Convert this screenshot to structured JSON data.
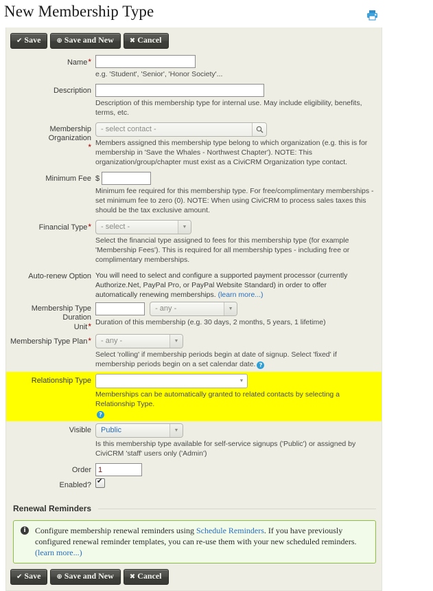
{
  "page": {
    "title": "New Membership Type",
    "print_icon": "printer-icon"
  },
  "toolbar": {
    "save_label": "Save",
    "save_icon": "✔",
    "save_new_label": "Save and New",
    "save_new_icon": "⊕",
    "cancel_label": "Cancel",
    "cancel_icon": "✖"
  },
  "fields": {
    "name": {
      "label": "Name",
      "required": "*",
      "value": "",
      "help": "e.g. 'Student', 'Senior', 'Honor Society'..."
    },
    "description": {
      "label": "Description",
      "value": "",
      "help": "Description of this membership type for internal use. May include eligibility, benefits, terms, etc."
    },
    "membership_organization": {
      "label": "Membership Organization",
      "required": "*",
      "value": "- select contact -",
      "search_icon": "search-icon",
      "help": "Members assigned this membership type belong to which organization (e.g. this is for membership in 'Save the Whales - Northwest Chapter'). NOTE: This organization/group/chapter must exist as a CiviCRM Organization type contact."
    },
    "minimum_fee": {
      "label": "Minimum Fee",
      "currency": "$",
      "value": "",
      "help": "Minimum fee required for this membership type. For free/complimentary memberships - set minimum fee to zero (0). NOTE: When using CiviCRM to process sales taxes this should be the tax exclusive amount."
    },
    "financial_type": {
      "label": "Financial Type",
      "required": "*",
      "value": "- select -",
      "help": "Select the financial type assigned to fees for this membership type (for example 'Membership Fees'). This is required for all membership types - including free or complimentary memberships."
    },
    "auto_renew": {
      "label": "Auto-renew Option",
      "text": "You will need to select and configure a supported payment processor (currently Authorize.Net, PayPal Pro, or PayPal Website Standard) in order to offer automatically renewing memberships.",
      "learn_more": "(learn more...)"
    },
    "duration": {
      "label_line1": "Membership Type Duration",
      "label_line2": "Unit",
      "required": "*",
      "interval_value": "",
      "unit_value": "- any -",
      "help": "Duration of this membership (e.g. 30 days, 2 months, 5 years, 1 lifetime)"
    },
    "plan": {
      "label": "Membership Type Plan",
      "required": "*",
      "value": "- any -",
      "help": "Select 'rolling' if membership periods begin at date of signup. Select 'fixed' if membership periods begin on a set calendar date.",
      "help_icon": "question-icon"
    },
    "relationship_type": {
      "label": "Relationship Type",
      "value": "",
      "help": "Memberships can be automatically granted to related contacts by selecting a Relationship Type.",
      "help_icon": "question-icon",
      "highlight_color": "#ffff00"
    },
    "visible": {
      "label": "Visible",
      "value": "Public",
      "help": "Is this membership type available for self-service signups ('Public') or assigned by CiviCRM 'staff' users only ('Admin')"
    },
    "order": {
      "label": "Order",
      "value": "1"
    },
    "enabled": {
      "label": "Enabled?",
      "checked": true
    }
  },
  "renewal_section": {
    "title": "Renewal Reminders",
    "info_icon": "info-icon",
    "info_text_before": "Configure membership renewal reminders using ",
    "info_link": "Schedule Reminders",
    "info_text_after": ". If you have previously configured renewal reminder templates, you can re-use them with your new scheduled reminders. ",
    "learn_more": "(learn more...)"
  },
  "colors": {
    "form_background": "#eeeee4",
    "highlight": "#ffff00",
    "link": "#2a6ebb",
    "required": "#9e0000",
    "info_border": "#8bbf3f",
    "info_background": "#f2faea"
  }
}
